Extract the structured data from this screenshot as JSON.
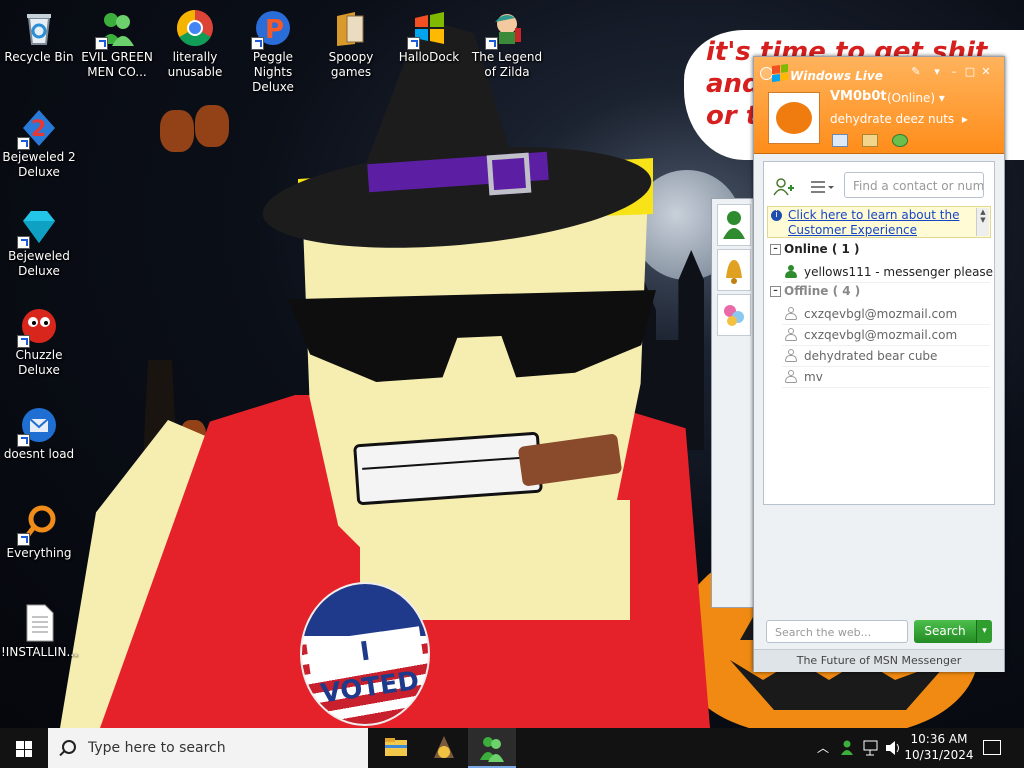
{
  "desktop": {
    "icons": [
      {
        "label": "Recycle Bin",
        "icon": "recycle-bin-icon"
      },
      {
        "label": "EVIL GREEN MEN CO...",
        "icon": "green-buddies-icon"
      },
      {
        "label": "literally unusable",
        "icon": "chrome-icon"
      },
      {
        "label": "Peggle Nights Deluxe",
        "icon": "peggle-icon"
      },
      {
        "label": "Spoopy games",
        "icon": "folder-icon"
      },
      {
        "label": "HalloDock",
        "icon": "windows-logo-icon"
      },
      {
        "label": "The Legend of Zilda",
        "icon": "zilda-icon"
      },
      {
        "label": "Bejeweled 2 Deluxe",
        "icon": "bejeweled2-icon"
      },
      {
        "label": "Bejeweled Deluxe",
        "icon": "diamond-icon"
      },
      {
        "label": "Chuzzle Deluxe",
        "icon": "chuzzle-icon"
      },
      {
        "label": "doesnt load",
        "icon": "thunderbird-icon"
      },
      {
        "label": "Everything",
        "icon": "everything-search-icon"
      },
      {
        "label": "!INSTALLIN...",
        "icon": "text-file-icon"
      }
    ]
  },
  "wallpaper": {
    "bubble_lines": [
      "it's time to get shit",
      "and",
      "or t"
    ],
    "badge_text": "I VOTED"
  },
  "messenger": {
    "title": "Windows Live",
    "display_name": "VM0b0t",
    "status": "(Online)",
    "personal_message": "dehydrate deez nuts",
    "find_placeholder": "Find a contact or number...",
    "promo_link": "Click here to learn about the Customer Experience",
    "groups": [
      {
        "label": "Online ( 1 )",
        "contacts": [
          "yellows111 - messenger please"
        ]
      },
      {
        "label": "Offline ( 4 )",
        "contacts": [
          "cxzqevbgl@mozmail.com",
          "cxzqevbgl@mozmail.com",
          "dehydrated bear cube",
          "mv"
        ]
      }
    ],
    "web_search_placeholder": "Search the web...",
    "search_button": "Search",
    "footer": "The Future of MSN Messenger",
    "colors": {
      "header": "#ff9a2e",
      "online": "#2e8b2e",
      "link": "#1646c8"
    }
  },
  "taskbar": {
    "search_placeholder": "Type here to search",
    "time": "10:36 AM",
    "date": "10/31/2024"
  }
}
